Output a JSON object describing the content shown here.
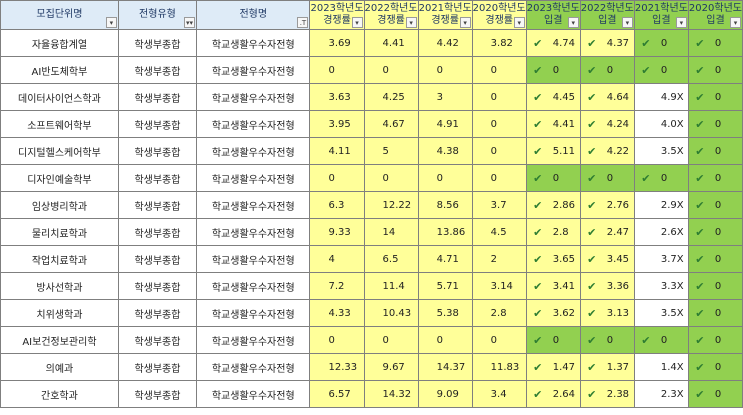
{
  "headers": [
    {
      "label": "모집단위명",
      "filter": "▾"
    },
    {
      "label": "전형유형",
      "filter": "▾"
    },
    {
      "label": "전형명",
      "filter": "▾"
    },
    {
      "label": "2023학년도 경쟁률",
      "filter": "▾"
    },
    {
      "label": "2022학년도 경쟁률",
      "filter": "▾"
    },
    {
      "label": "2021학년도 경쟁률",
      "filter": "▾"
    },
    {
      "label": "2020학년도 경쟁률",
      "filter": "▾"
    },
    {
      "label": "2023학년도 입결",
      "filter": "▾"
    },
    {
      "label": "2022학년도 입결",
      "filter": "▾"
    },
    {
      "label": "2021학년도 입결",
      "filter": "▾"
    },
    {
      "label": "2020학년도 입결",
      "filter": "▾"
    }
  ],
  "header_lines": [
    [
      "모집단위명"
    ],
    [
      "전형유형"
    ],
    [
      "전형명"
    ],
    [
      "2023학년도",
      "경쟁률"
    ],
    [
      "2022학년도",
      "경쟁률"
    ],
    [
      "2021학년도",
      "경쟁률"
    ],
    [
      "2020학년도",
      "경쟁률"
    ],
    [
      "2023학년도",
      "입결"
    ],
    [
      "2022학년도",
      "입결"
    ],
    [
      "2021학년도",
      "입결"
    ],
    [
      "2020학년도",
      "입결"
    ]
  ],
  "filter_glyphs": [
    "▾",
    "▾▾",
    ".T",
    "▾",
    "▾",
    "▾",
    "▾",
    "▾",
    "▾",
    "▾",
    "▾"
  ],
  "rows": [
    {
      "name": "자율융합계열",
      "type": "학생부종합",
      "track": "학교생활우수자전형",
      "r2023": "3.69",
      "r2022": "4.41",
      "r2021": "4.42",
      "r2020": "3.82",
      "c2023": "4.74",
      "c2022": "4.37",
      "c2021": "0",
      "c2020": "0",
      "chk": [
        true,
        true,
        true,
        true
      ]
    },
    {
      "name": "AI반도체학부",
      "type": "학생부종합",
      "track": "학교생활우수자전형",
      "r2023": "0",
      "r2022": "0",
      "r2021": "0",
      "r2020": "0",
      "c2023": "0",
      "c2022": "0",
      "c2021": "0",
      "c2020": "0",
      "chk": [
        true,
        true,
        true,
        true
      ]
    },
    {
      "name": "데이터사이언스학과",
      "type": "학생부종합",
      "track": "학교생활우수자전형",
      "r2023": "3.63",
      "r2022": "4.25",
      "r2021": "3",
      "r2020": "0",
      "c2023": "4.45",
      "c2022": "4.64",
      "c2021": "4.9X",
      "c2020": "0",
      "chk": [
        true,
        true,
        false,
        true
      ]
    },
    {
      "name": "소프트웨어학부",
      "type": "학생부종합",
      "track": "학교생활우수자전형",
      "r2023": "3.95",
      "r2022": "4.67",
      "r2021": "4.91",
      "r2020": "0",
      "c2023": "4.41",
      "c2022": "4.24",
      "c2021": "4.0X",
      "c2020": "0",
      "chk": [
        true,
        true,
        false,
        true
      ]
    },
    {
      "name": "디지털헬스케어학부",
      "type": "학생부종합",
      "track": "학교생활우수자전형",
      "r2023": "4.11",
      "r2022": "5",
      "r2021": "4.38",
      "r2020": "0",
      "c2023": "5.11",
      "c2022": "4.22",
      "c2021": "3.5X",
      "c2020": "0",
      "chk": [
        true,
        true,
        false,
        true
      ]
    },
    {
      "name": "디자인예술학부",
      "type": "학생부종합",
      "track": "학교생활우수자전형",
      "r2023": "0",
      "r2022": "0",
      "r2021": "0",
      "r2020": "0",
      "c2023": "0",
      "c2022": "0",
      "c2021": "0",
      "c2020": "0",
      "chk": [
        true,
        true,
        true,
        true
      ]
    },
    {
      "name": "임상병리학과",
      "type": "학생부종합",
      "track": "학교생활우수자전형",
      "r2023": "6.3",
      "r2022": "12.22",
      "r2021": "8.56",
      "r2020": "3.7",
      "c2023": "2.86",
      "c2022": "2.76",
      "c2021": "2.9X",
      "c2020": "0",
      "chk": [
        true,
        true,
        false,
        true
      ]
    },
    {
      "name": "물리치료학과",
      "type": "학생부종합",
      "track": "학교생활우수자전형",
      "r2023": "9.33",
      "r2022": "14",
      "r2021": "13.86",
      "r2020": "4.5",
      "c2023": "2.8",
      "c2022": "2.47",
      "c2021": "2.6X",
      "c2020": "0",
      "chk": [
        true,
        true,
        false,
        true
      ]
    },
    {
      "name": "작업치료학과",
      "type": "학생부종합",
      "track": "학교생활우수자전형",
      "r2023": "4",
      "r2022": "6.5",
      "r2021": "4.71",
      "r2020": "2",
      "c2023": "3.65",
      "c2022": "3.45",
      "c2021": "3.7X",
      "c2020": "0",
      "chk": [
        true,
        true,
        false,
        true
      ]
    },
    {
      "name": "방사선학과",
      "type": "학생부종합",
      "track": "학교생활우수자전형",
      "r2023": "7.2",
      "r2022": "11.4",
      "r2021": "5.71",
      "r2020": "3.14",
      "c2023": "3.41",
      "c2022": "3.36",
      "c2021": "3.3X",
      "c2020": "0",
      "chk": [
        true,
        true,
        false,
        true
      ]
    },
    {
      "name": "치위생학과",
      "type": "학생부종합",
      "track": "학교생활우수자전형",
      "r2023": "4.33",
      "r2022": "10.43",
      "r2021": "5.38",
      "r2020": "2.8",
      "c2023": "3.62",
      "c2022": "3.13",
      "c2021": "3.5X",
      "c2020": "0",
      "chk": [
        true,
        true,
        false,
        true
      ]
    },
    {
      "name": "AI보건정보관리학",
      "type": "학생부종합",
      "track": "학교생활우수자전형",
      "r2023": "0",
      "r2022": "0",
      "r2021": "0",
      "r2020": "0",
      "c2023": "0",
      "c2022": "0",
      "c2021": "0",
      "c2020": "0",
      "chk": [
        true,
        true,
        true,
        true
      ]
    },
    {
      "name": "의예과",
      "type": "학생부종합",
      "track": "학교생활우수자전형",
      "r2023": "12.33",
      "r2022": "9.67",
      "r2021": "14.37",
      "r2020": "11.83",
      "c2023": "1.47",
      "c2022": "1.37",
      "c2021": "1.4X",
      "c2020": "0",
      "chk": [
        true,
        true,
        false,
        true
      ]
    },
    {
      "name": "간호학과",
      "type": "학생부종합",
      "track": "학교생활우수자전형",
      "r2023": "6.57",
      "r2022": "14.32",
      "r2021": "9.09",
      "r2020": "3.4",
      "c2023": "2.64",
      "c2022": "2.38",
      "c2021": "2.3X",
      "c2020": "0",
      "chk": [
        true,
        true,
        false,
        true
      ]
    }
  ],
  "colors": {
    "header_bg": "#deebf7",
    "rate_bg": "#ffff99",
    "green": "#92d050",
    "check": "#2e7d32"
  },
  "check_glyph": "✔"
}
